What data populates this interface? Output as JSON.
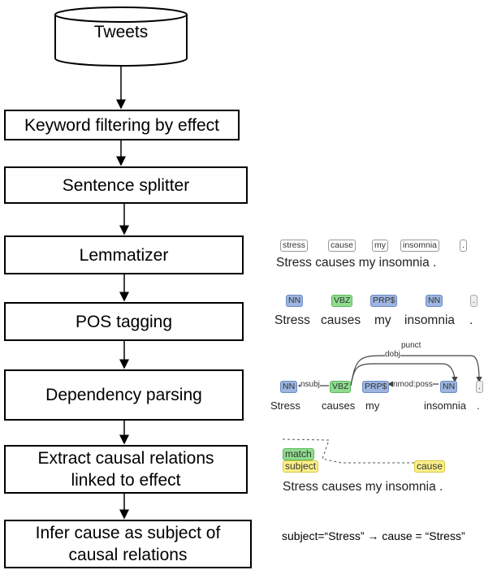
{
  "flow": {
    "source": "Tweets",
    "steps": [
      "Keyword filtering by effect",
      "Sentence splitter",
      "Lemmatizer",
      "POS tagging",
      "Dependency parsing",
      "Extract causal relations linked to effect",
      "Infer cause as subject of causal relations"
    ]
  },
  "examples": {
    "lemmas": [
      "stress",
      "cause",
      "my",
      "insomnia",
      "."
    ],
    "sentence_words": [
      "Stress",
      "causes",
      "my",
      "insomnia",
      "."
    ],
    "pos": [
      "NN",
      "VBZ",
      "PRP$",
      "NN",
      "."
    ],
    "deps": [
      "nsubj",
      "dobj",
      "punct",
      "nmod:poss"
    ],
    "causal": {
      "match": "match",
      "subject": "subject",
      "cause": "cause"
    },
    "inference": "subject=“Stress” → cause = “Stress”"
  },
  "colors": {
    "noun": "#9db5e0",
    "verb": "#8edc8e",
    "role": "#fbf08a"
  }
}
